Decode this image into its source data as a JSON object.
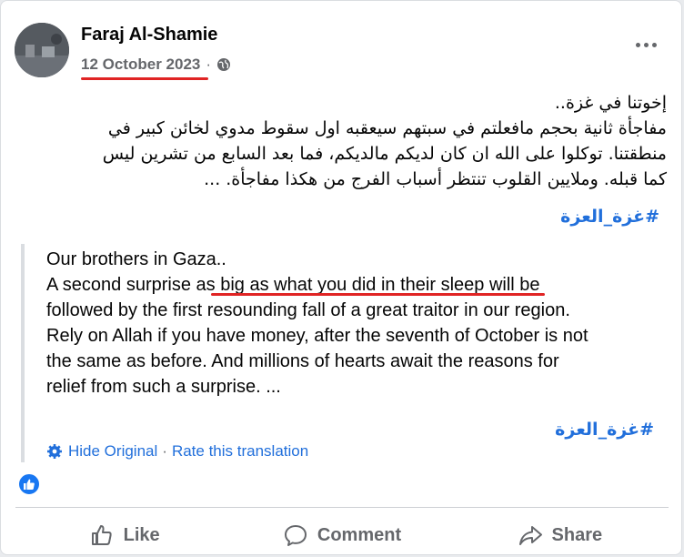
{
  "post": {
    "author": "Faraj Al-Shamie",
    "date": "12 October 2023",
    "separator": "·",
    "arabic_lines": [
      "إخوتنا في غزة..",
      "مفاجأة ثانية بحجم مافعلتم في سبتهم سيعقبه اول سقوط مدوي لخائن كبير في",
      "منطقتنا. توكلوا على الله ان كان لديكم مالديكم، فما بعد السابع من تشرين ليس",
      "كما قبله.   وملايين القلوب تنتظر أسباب الفرج من هكذا مفاجأة. ..."
    ],
    "hashtag": "#غزة_العزة",
    "translation": {
      "line1": "Our brothers in Gaza..",
      "line2_pre": "A second surprise ",
      "line2_mark": "as big as what you did in their sleep",
      "line2_post": " will be",
      "line3": "followed by the first resounding fall of a great traitor in our region.",
      "line4": "Rely on Allah if you have money, after the seventh of October is not",
      "line5": "the same as before. And millions of hearts await the reasons for",
      "line6": "relief from such a surprise. ...",
      "hashtag": "#غزة_العزة",
      "hide_original": "Hide Original",
      "link_sep": "·",
      "rate": "Rate this translation"
    }
  },
  "actions": {
    "like": "Like",
    "comment": "Comment",
    "share": "Share"
  },
  "colors": {
    "link": "#216fdb",
    "secondary_text": "#65676b",
    "annotation_red": "#e02424",
    "like_blue": "#1877f2"
  }
}
